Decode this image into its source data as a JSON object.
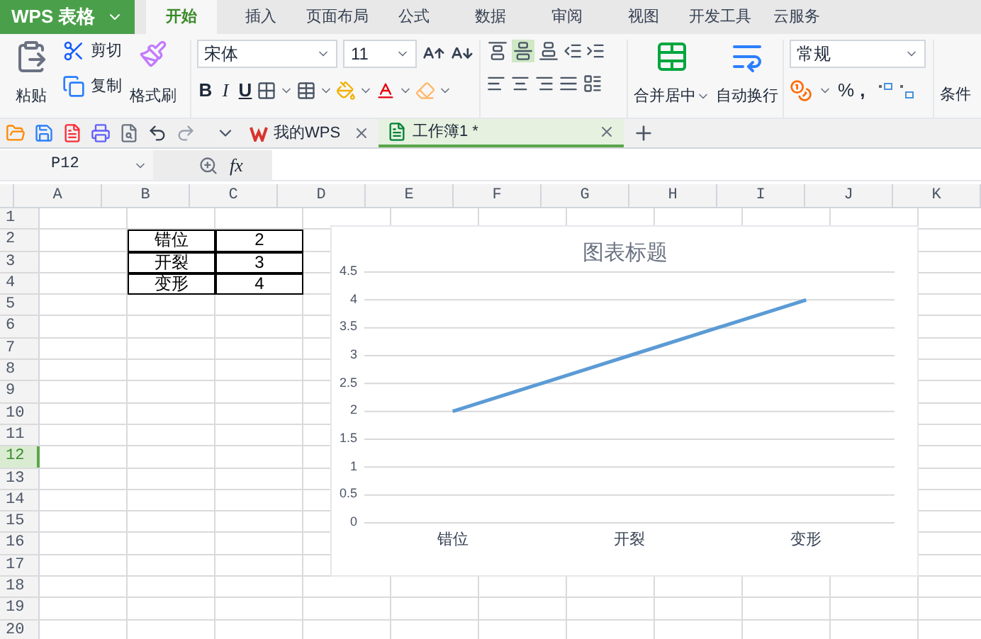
{
  "app_menu": {
    "label": "WPS 表格"
  },
  "tabs": [
    {
      "label": "开始",
      "selected": true
    },
    {
      "label": "插入",
      "selected": false
    },
    {
      "label": "页面布局",
      "selected": false
    },
    {
      "label": "公式",
      "selected": false
    },
    {
      "label": "数据",
      "selected": false
    },
    {
      "label": "审阅",
      "selected": false
    },
    {
      "label": "视图",
      "selected": false
    },
    {
      "label": "开发工具",
      "selected": false
    },
    {
      "label": "云服务",
      "selected": false
    }
  ],
  "ribbon": {
    "paste": "粘贴",
    "cut": "剪切",
    "copy": "复制",
    "format_painter": "格式刷",
    "font_name": "宋体",
    "font_size": "11",
    "bold": "B",
    "italic": "I",
    "underline": "U",
    "vertical_align": [
      {
        "selected": false
      },
      {
        "selected": true
      },
      {
        "selected": false
      }
    ],
    "merge": "合并居中",
    "wrap": "自动换行",
    "number_format": "常规",
    "percent": "%",
    "comma": ",",
    "conditional": "条件"
  },
  "doc_tabs": [
    {
      "label": "我的WPS",
      "kind": "home",
      "selected": false
    },
    {
      "label": "工作簿1 *",
      "kind": "sheet",
      "selected": true
    }
  ],
  "formula_bar": {
    "name_box": "P12",
    "fx": "fx"
  },
  "sheet": {
    "columns": [
      "A",
      "B",
      "C",
      "D",
      "E",
      "F",
      "G",
      "H",
      "I",
      "J",
      "K"
    ],
    "rows": [
      {
        "label": "1",
        "selected": false
      },
      {
        "label": "2",
        "selected": false
      },
      {
        "label": "3",
        "selected": false
      },
      {
        "label": "4",
        "selected": false
      },
      {
        "label": "5",
        "selected": false
      },
      {
        "label": "6",
        "selected": false
      },
      {
        "label": "7",
        "selected": false
      },
      {
        "label": "8",
        "selected": false
      },
      {
        "label": "9",
        "selected": false
      },
      {
        "label": "10",
        "selected": false
      },
      {
        "label": "11",
        "selected": false
      },
      {
        "label": "12",
        "selected": true
      },
      {
        "label": "13",
        "selected": false
      },
      {
        "label": "14",
        "selected": false
      },
      {
        "label": "15",
        "selected": false
      },
      {
        "label": "16",
        "selected": false
      },
      {
        "label": "17",
        "selected": false
      },
      {
        "label": "18",
        "selected": false
      },
      {
        "label": "19",
        "selected": false
      },
      {
        "label": "20",
        "selected": false
      }
    ],
    "table": [
      [
        "错位",
        "2"
      ],
      [
        "开裂",
        "3"
      ],
      [
        "变形",
        "4"
      ]
    ],
    "chart_data": {
      "type": "line",
      "title": "图表标题",
      "categories": [
        "错位",
        "开裂",
        "变形"
      ],
      "series": [
        {
          "color": "#5b9bd5",
          "values": [
            2,
            3,
            4
          ]
        }
      ],
      "ylim": [
        0,
        4.5
      ],
      "grid": true,
      "yticks": [
        0,
        0.5,
        1,
        1.5,
        2,
        2.5,
        3,
        3.5,
        4,
        4.5
      ]
    }
  }
}
